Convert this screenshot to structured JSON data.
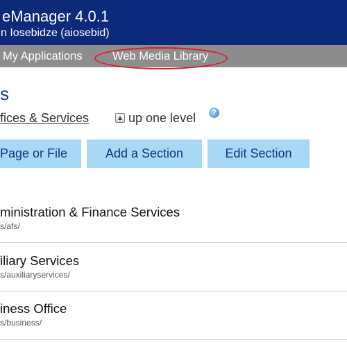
{
  "header": {
    "app_title": "eManager 4.0.1",
    "user_line": "n Iosebidze (aiosebid)"
  },
  "nav": {
    "items": [
      {
        "label": "My Applications"
      },
      {
        "label": "Web Media Library"
      }
    ]
  },
  "page": {
    "title": "s",
    "breadcrumb": "fices & Services",
    "up_level": "up one level"
  },
  "toolbar": {
    "page_file_label": "Page or File",
    "add_section_label": "Add a Section",
    "edit_section_label": "Edit Section"
  },
  "sections": [
    {
      "name": "ministration & Finance Services",
      "path": "s/afs/"
    },
    {
      "name": "iliary Services",
      "path": "s/auxiliaryservices/"
    },
    {
      "name": "iness Office",
      "path": "s/business/"
    }
  ],
  "colors": {
    "header_bg": "#0c2a7a",
    "nav_bg": "#8d8d8d",
    "button_bg": "#a7d9f6",
    "highlight": "#e4172b"
  }
}
